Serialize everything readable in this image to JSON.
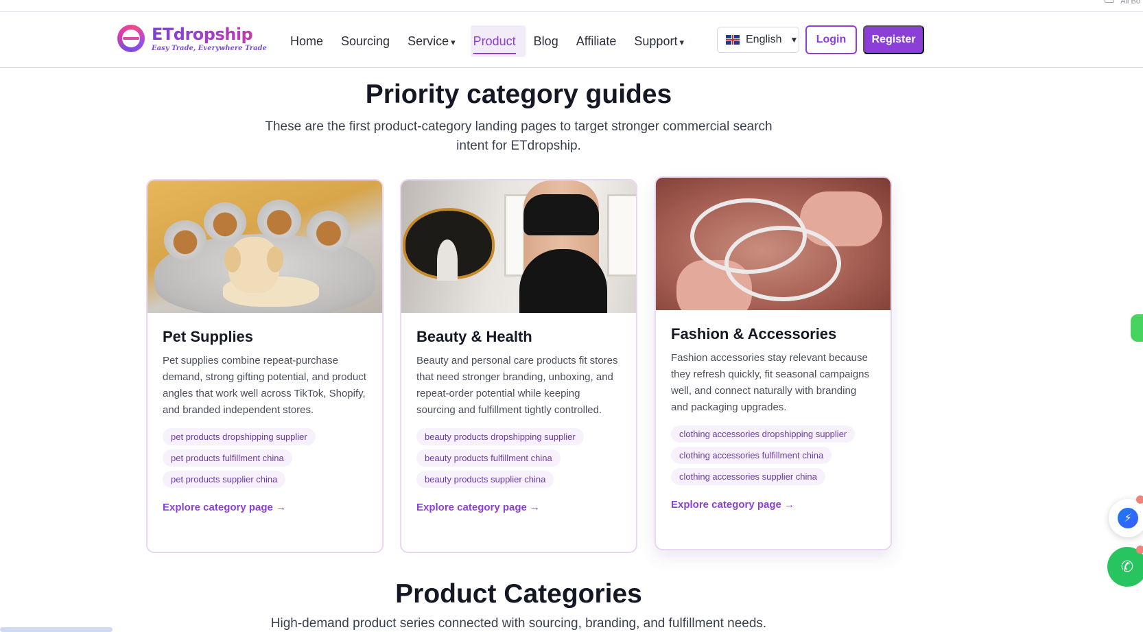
{
  "window": {
    "corner_text": "All Bo"
  },
  "brand": {
    "name": "ETdropship",
    "tagline": "Easy Trade, Everywhere Trade"
  },
  "nav": {
    "items": [
      {
        "label": "Home",
        "dropdown": false,
        "active": false
      },
      {
        "label": "Sourcing",
        "dropdown": false,
        "active": false
      },
      {
        "label": "Service",
        "dropdown": true,
        "active": false
      },
      {
        "label": "Product",
        "dropdown": false,
        "active": true
      },
      {
        "label": "Blog",
        "dropdown": false,
        "active": false
      },
      {
        "label": "Affiliate",
        "dropdown": false,
        "active": false
      },
      {
        "label": "Support",
        "dropdown": true,
        "active": false
      }
    ],
    "caret": "▾",
    "language": "English",
    "language_caret": "▼",
    "login_label": "Login",
    "register_label": "Register"
  },
  "priority": {
    "title": "Priority category guides",
    "subtitle": "These are the first product-category landing pages to target stronger commercial search intent for ETdropship."
  },
  "cards": [
    {
      "title": "Pet Supplies",
      "description": "Pet supplies combine repeat-purchase demand, strong gifting potential, and product angles that work well across TikTok, Shopify, and branded independent stores.",
      "tags": [
        "pet products dropshipping supplier",
        "pet products fulfillment china",
        "pet products supplier china"
      ],
      "link": "Explore category page →"
    },
    {
      "title": "Beauty & Health",
      "description": "Beauty and personal care products fit stores that need stronger branding, unboxing, and repeat-order potential while keeping sourcing and fulfillment tightly controlled.",
      "tags": [
        "beauty products dropshipping supplier",
        "beauty products fulfillment china",
        "beauty products supplier china"
      ],
      "link": "Explore category page →"
    },
    {
      "title": "Fashion & Accessories",
      "description": "Fashion accessories stay relevant because they refresh quickly, fit seasonal campaigns well, and connect naturally with branding and packaging upgrades.",
      "tags": [
        "clothing accessories dropshipping supplier",
        "clothing accessories fulfillment china",
        "clothing accessories supplier china"
      ],
      "link": "Explore category page →"
    }
  ],
  "product_categories": {
    "title": "Product Categories",
    "subtitle": "High-demand product series connected with sourcing, branding, and fulfillment needs."
  },
  "colors": {
    "accent": "#8b3fd6",
    "whatsapp": "#27c45f",
    "messenger": "#1a7cf5"
  },
  "floating": {
    "messenger_icon": "messenger-icon",
    "whatsapp_icon": "whatsapp-icon"
  }
}
